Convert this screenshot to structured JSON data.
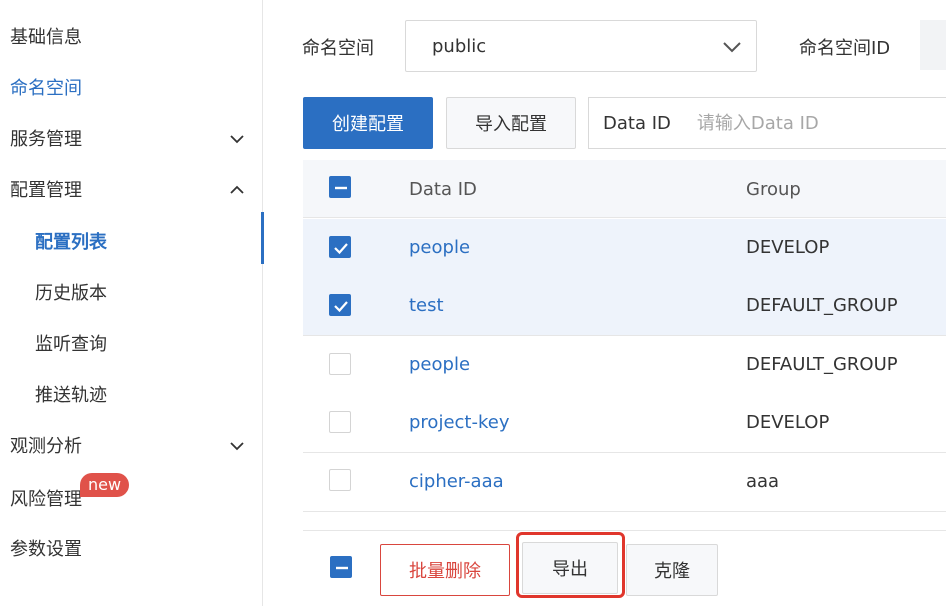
{
  "sidebar": {
    "items": [
      {
        "label": "基础信息"
      },
      {
        "label": "命名空间"
      },
      {
        "label": "服务管理"
      },
      {
        "label": "配置管理"
      },
      {
        "label": "配置列表"
      },
      {
        "label": "历史版本"
      },
      {
        "label": "监听查询"
      },
      {
        "label": "推送轨迹"
      },
      {
        "label": "观测分析"
      },
      {
        "label": "风险管理",
        "badge": "new"
      },
      {
        "label": "参数设置"
      }
    ]
  },
  "header": {
    "namespace_label": "命名空间",
    "namespace_value": "public",
    "namespace_id_label": "命名空间ID"
  },
  "toolbar": {
    "create_label": "创建配置",
    "import_label": "导入配置",
    "data_id_label": "Data ID",
    "data_id_placeholder": "请输入Data ID"
  },
  "table": {
    "columns": [
      "Data ID",
      "Group"
    ],
    "rows": [
      {
        "data_id": "people",
        "group": "DEVELOP",
        "checked": true
      },
      {
        "data_id": "test",
        "group": "DEFAULT_GROUP",
        "checked": true
      },
      {
        "data_id": "people",
        "group": "DEFAULT_GROUP",
        "checked": false
      },
      {
        "data_id": "project-key",
        "group": "DEVELOP",
        "checked": false
      },
      {
        "data_id": "cipher-aaa",
        "group": "aaa",
        "checked": false
      }
    ]
  },
  "footer": {
    "delete_label": "批量删除",
    "export_label": "导出",
    "clone_label": "克隆"
  },
  "colors": {
    "accent": "#2b6fc2",
    "danger": "#d9463e",
    "highlight": "#e0362c",
    "badge": "#e0524a"
  }
}
